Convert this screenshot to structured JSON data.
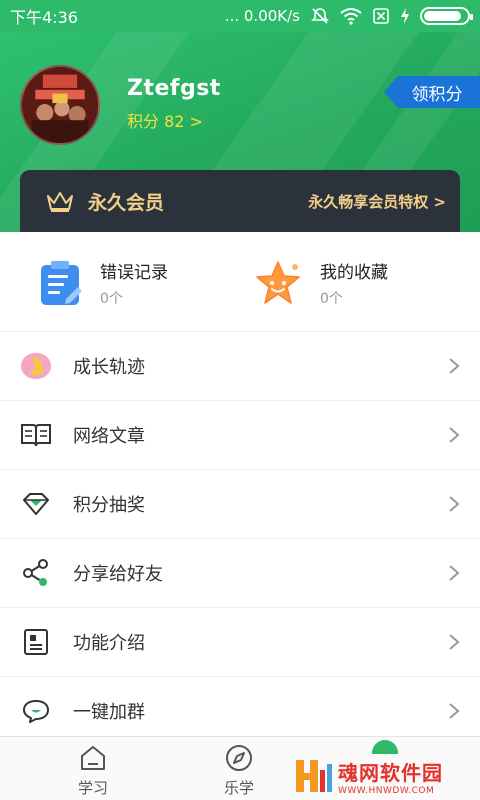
{
  "status_bar": {
    "time": "下午4:36",
    "net_speed": "... 0.00K/s"
  },
  "header": {
    "username": "Ztefgst",
    "points_text": "积分 82 >",
    "points_button": "领积分"
  },
  "vip": {
    "title": "永久会员",
    "link": "永久畅享会员特权 >"
  },
  "quick": [
    {
      "title": "错误记录",
      "count": "0个",
      "icon": "notepad-icon"
    },
    {
      "title": "我的收藏",
      "count": "0个",
      "icon": "star-icon"
    }
  ],
  "list": [
    {
      "label": "成长轨迹",
      "icon": "moon-icon"
    },
    {
      "label": "网络文章",
      "icon": "open-book-icon"
    },
    {
      "label": "积分抽奖",
      "icon": "diamond-icon"
    },
    {
      "label": "分享给好友",
      "icon": "share-icon"
    },
    {
      "label": "功能介绍",
      "icon": "document-icon"
    },
    {
      "label": "一键加群",
      "icon": "chat-icon"
    }
  ],
  "bottom_nav": [
    {
      "label": "学习",
      "icon": "home-icon"
    },
    {
      "label": "乐学",
      "icon": "compass-icon"
    }
  ],
  "watermark": {
    "title": "魂网软件园",
    "url": "WWW.HNWDW.COM"
  },
  "colors": {
    "brand_green": "#2dba6b",
    "vip_gold": "#f3d089",
    "points_yellow": "#f5e23a",
    "button_blue": "#1a74d8"
  }
}
